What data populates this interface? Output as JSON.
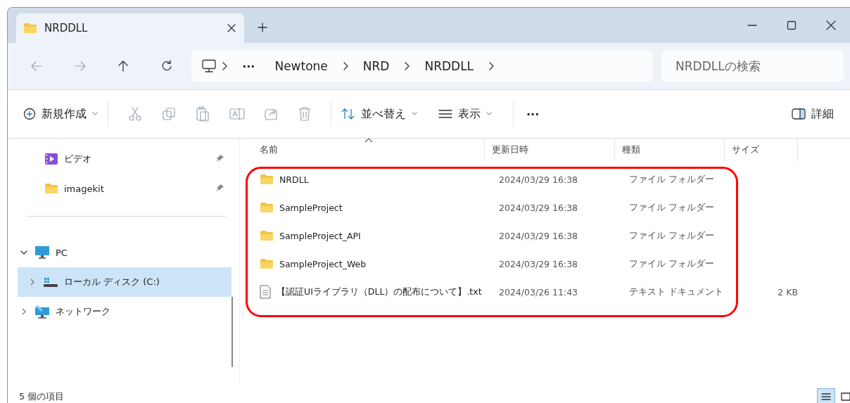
{
  "window": {
    "tab": {
      "title": "NRDDLL"
    }
  },
  "address_bar": {
    "overflow": "···",
    "breadcrumbs": [
      "Newtone",
      "NRD",
      "NRDDLL"
    ],
    "search": {
      "placeholder": "NRDDLLの検索"
    }
  },
  "toolbar": {
    "new": "新規作成",
    "sort": "並べ替え",
    "view": "表示",
    "more": "···",
    "details": "詳細"
  },
  "sidebar": {
    "items": [
      {
        "label": "ビデオ",
        "kind": "video",
        "pinned": true,
        "selected": false
      },
      {
        "label": "imagekit",
        "kind": "folder",
        "pinned": true,
        "selected": false
      },
      {
        "kind": "divider"
      },
      {
        "label": "PC",
        "kind": "pc",
        "expanded": true,
        "selected": false,
        "children": [
          {
            "label": "ローカル ディスク (C:)",
            "kind": "drive",
            "expanded": false,
            "selected": true
          }
        ]
      },
      {
        "label": "ネットワーク",
        "kind": "network",
        "expanded": false,
        "selected": false
      }
    ]
  },
  "table": {
    "columns": [
      {
        "label": "名前",
        "sorted": true
      },
      {
        "label": "更新日時",
        "sorted": false
      },
      {
        "label": "種類",
        "sorted": false
      },
      {
        "label": "サイズ",
        "sorted": false
      }
    ],
    "rows": [
      {
        "kind": "folder",
        "name": "NRDLL",
        "modified": "2024/03/29 16:38",
        "type": "ファイル フォルダー"
      },
      {
        "kind": "folder",
        "name": "SampleProject",
        "modified": "2024/03/29 16:38",
        "type": "ファイル フォルダー"
      },
      {
        "kind": "folder",
        "name": "SampleProject_API",
        "modified": "2024/03/29 16:38",
        "type": "ファイル フォルダー"
      },
      {
        "kind": "folder",
        "name": "SampleProject_Web",
        "modified": "2024/03/29 16:38",
        "type": "ファイル フォルダー"
      },
      {
        "kind": "file",
        "name": "【認証UIライブラリ（DLL）の配布について】.txt",
        "modified": "2024/03/26 11:43",
        "type": "テキスト ドキュメント",
        "size": "2 KB"
      }
    ]
  },
  "status_bar": {
    "count": "5 個の項目",
    "views": [
      {
        "kind": "details",
        "selected": true
      },
      {
        "kind": "tiles",
        "selected": false
      }
    ]
  }
}
